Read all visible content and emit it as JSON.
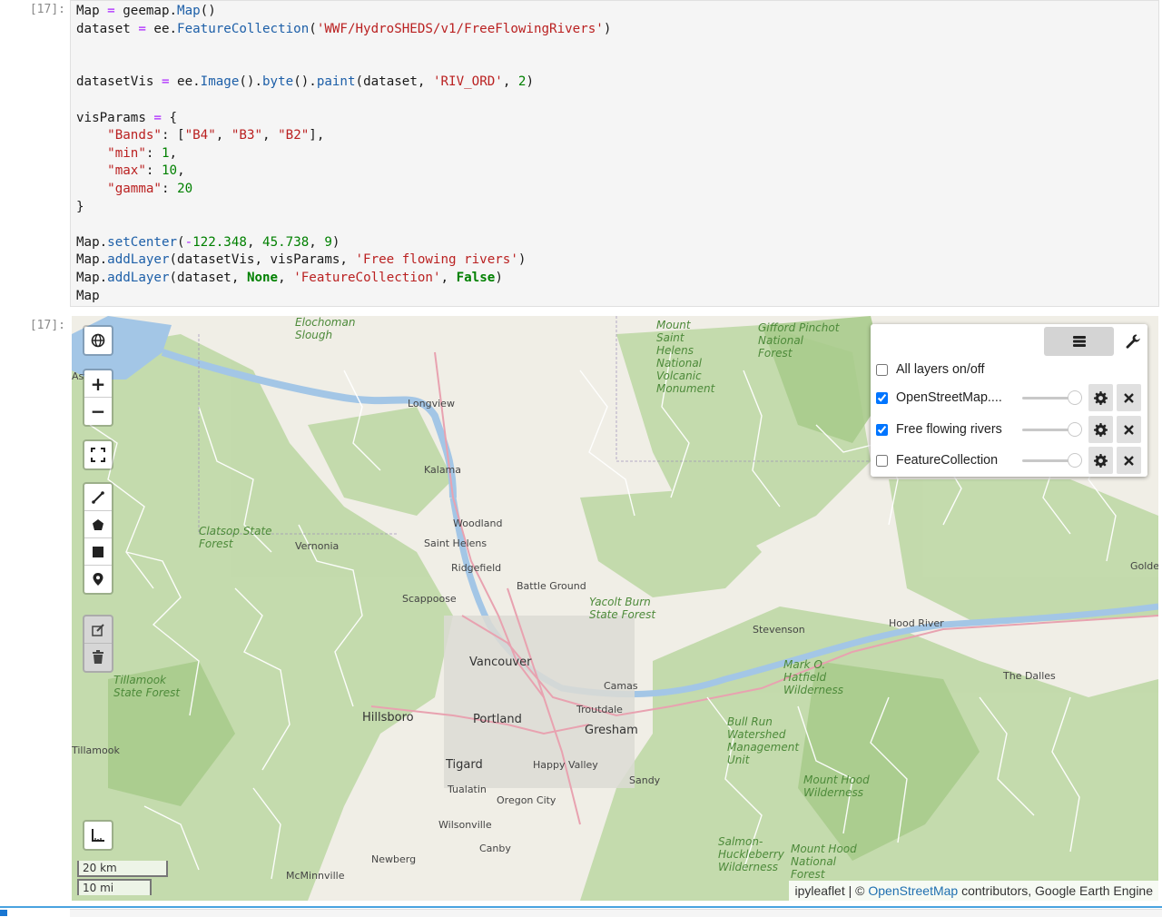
{
  "cell": {
    "input_prompt": "[17]:",
    "output_prompt": "[17]:",
    "code_lines": [
      [
        [
          "Map",
          "t-punc"
        ],
        [
          " = ",
          "t-op"
        ],
        [
          "geemap.",
          "t-punc"
        ],
        [
          "Map",
          "t-fn"
        ],
        [
          "()",
          "t-punc"
        ]
      ],
      [
        [
          "dataset",
          "t-punc"
        ],
        [
          " = ",
          "t-op"
        ],
        [
          "ee.",
          "t-punc"
        ],
        [
          "FeatureCollection",
          "t-fn"
        ],
        [
          "(",
          "t-punc"
        ],
        [
          "'WWF/HydroSHEDS/v1/FreeFlowingRivers'",
          "t-str"
        ],
        [
          ")",
          "t-punc"
        ]
      ],
      [],
      [],
      [
        [
          "datasetVis",
          "t-punc"
        ],
        [
          " = ",
          "t-op"
        ],
        [
          "ee.",
          "t-punc"
        ],
        [
          "Image",
          "t-fn"
        ],
        [
          "().",
          "t-punc"
        ],
        [
          "byte",
          "t-fn"
        ],
        [
          "().",
          "t-punc"
        ],
        [
          "paint",
          "t-fn"
        ],
        [
          "(dataset, ",
          "t-punc"
        ],
        [
          "'RIV_ORD'",
          "t-str"
        ],
        [
          ", ",
          "t-punc"
        ],
        [
          "2",
          "t-num"
        ],
        [
          ")",
          "t-punc"
        ]
      ],
      [],
      [
        [
          "visParams",
          "t-punc"
        ],
        [
          " = ",
          "t-op"
        ],
        [
          "{",
          "t-punc"
        ]
      ],
      [
        [
          "    ",
          "t-punc"
        ],
        [
          "\"Bands\"",
          "t-str"
        ],
        [
          ": [",
          "t-punc"
        ],
        [
          "\"B4\"",
          "t-str"
        ],
        [
          ", ",
          "t-punc"
        ],
        [
          "\"B3\"",
          "t-str"
        ],
        [
          ", ",
          "t-punc"
        ],
        [
          "\"B2\"",
          "t-str"
        ],
        [
          "],",
          "t-punc"
        ]
      ],
      [
        [
          "    ",
          "t-punc"
        ],
        [
          "\"min\"",
          "t-str"
        ],
        [
          ": ",
          "t-punc"
        ],
        [
          "1",
          "t-num"
        ],
        [
          ",",
          "t-punc"
        ]
      ],
      [
        [
          "    ",
          "t-punc"
        ],
        [
          "\"max\"",
          "t-str"
        ],
        [
          ": ",
          "t-punc"
        ],
        [
          "10",
          "t-num"
        ],
        [
          ",",
          "t-punc"
        ]
      ],
      [
        [
          "    ",
          "t-punc"
        ],
        [
          "\"gamma\"",
          "t-str"
        ],
        [
          ": ",
          "t-punc"
        ],
        [
          "20",
          "t-num"
        ]
      ],
      [
        [
          "}",
          "t-punc"
        ]
      ],
      [],
      [
        [
          "Map.",
          "t-punc"
        ],
        [
          "setCenter",
          "t-fn"
        ],
        [
          "(",
          "t-punc"
        ],
        [
          "-",
          "t-op"
        ],
        [
          "122.348",
          "t-num"
        ],
        [
          ", ",
          "t-punc"
        ],
        [
          "45.738",
          "t-num"
        ],
        [
          ", ",
          "t-punc"
        ],
        [
          "9",
          "t-num"
        ],
        [
          ")",
          "t-punc"
        ]
      ],
      [
        [
          "Map.",
          "t-punc"
        ],
        [
          "addLayer",
          "t-fn"
        ],
        [
          "(datasetVis, visParams, ",
          "t-punc"
        ],
        [
          "'Free flowing rivers'",
          "t-str"
        ],
        [
          ")",
          "t-punc"
        ]
      ],
      [
        [
          "Map.",
          "t-punc"
        ],
        [
          "addLayer",
          "t-fn"
        ],
        [
          "(dataset, ",
          "t-punc"
        ],
        [
          "None",
          "t-kw"
        ],
        [
          ", ",
          "t-punc"
        ],
        [
          "'FeatureCollection'",
          "t-str"
        ],
        [
          ", ",
          "t-punc"
        ],
        [
          "False",
          "t-kw"
        ],
        [
          ")",
          "t-punc"
        ]
      ],
      [
        [
          "Map",
          "t-punc"
        ]
      ]
    ]
  },
  "map": {
    "zoom_in_label": "+",
    "zoom_out_label": "−",
    "layers": [
      {
        "name": "All layers on/off",
        "checked": false,
        "has_controls": false
      },
      {
        "name": "OpenStreetMap....",
        "checked": true,
        "has_controls": true
      },
      {
        "name": "Free flowing rivers",
        "checked": true,
        "has_controls": true
      },
      {
        "name": "FeatureCollection",
        "checked": false,
        "has_controls": true
      }
    ],
    "scale_km": "20 km",
    "scale_mi": "10 mi",
    "attribution_prefix": "ipyleaflet | © ",
    "attribution_link": "OpenStreetMap",
    "attribution_suffix": " contributors, Google Earth Engine",
    "place_labels": [
      {
        "text": "Kalama",
        "cls": ""
      },
      {
        "text": "Woodland",
        "cls": ""
      },
      {
        "text": "Saint Helens",
        "cls": ""
      },
      {
        "text": "Ridgefield",
        "cls": ""
      },
      {
        "text": "Vernonia",
        "cls": ""
      },
      {
        "text": "Scappoose",
        "cls": ""
      },
      {
        "text": "Battle Ground",
        "cls": ""
      },
      {
        "text": "Vancouver",
        "cls": "big"
      },
      {
        "text": "Camas",
        "cls": ""
      },
      {
        "text": "Troutdale",
        "cls": ""
      },
      {
        "text": "Hillsboro",
        "cls": "big"
      },
      {
        "text": "Portland",
        "cls": "big"
      },
      {
        "text": "Gresham",
        "cls": "big"
      },
      {
        "text": "Tigard",
        "cls": "big"
      },
      {
        "text": "Happy Valley",
        "cls": ""
      },
      {
        "text": "Tualatin",
        "cls": ""
      },
      {
        "text": "Oregon City",
        "cls": ""
      },
      {
        "text": "Sandy",
        "cls": ""
      },
      {
        "text": "Newberg",
        "cls": ""
      },
      {
        "text": "Wilsonville",
        "cls": ""
      },
      {
        "text": "Canby",
        "cls": ""
      },
      {
        "text": "McMinnville",
        "cls": ""
      },
      {
        "text": "Stevenson",
        "cls": ""
      },
      {
        "text": "Hood River",
        "cls": ""
      },
      {
        "text": "The Dalles",
        "cls": ""
      },
      {
        "text": "Longview",
        "cls": ""
      },
      {
        "text": "Goldendale",
        "cls": ""
      },
      {
        "text": "Clatsop State Forest",
        "cls": "forest"
      },
      {
        "text": "Tillamook State Forest",
        "cls": "forest"
      },
      {
        "text": "Yacolt Burn State Forest",
        "cls": "forest"
      },
      {
        "text": "Gifford Pinchot National Forest",
        "cls": "forest"
      },
      {
        "text": "Mount Hood National Forest",
        "cls": "forest"
      },
      {
        "text": "Mount Hood Wilderness",
        "cls": "forest"
      },
      {
        "text": "Mount Saint Helens National Volcanic Monument",
        "cls": "forest"
      },
      {
        "text": "Bull Run Watershed Management Unit",
        "cls": "forest"
      },
      {
        "text": "Salmon-Huckleberry Wilderness",
        "cls": "forest"
      },
      {
        "text": "Mark O. Hatfield Wilderness",
        "cls": "forest"
      },
      {
        "text": "Elochoman Slough",
        "cls": "forest"
      },
      {
        "text": "Astoria",
        "cls": ""
      },
      {
        "text": "Tillamook",
        "cls": ""
      }
    ]
  }
}
